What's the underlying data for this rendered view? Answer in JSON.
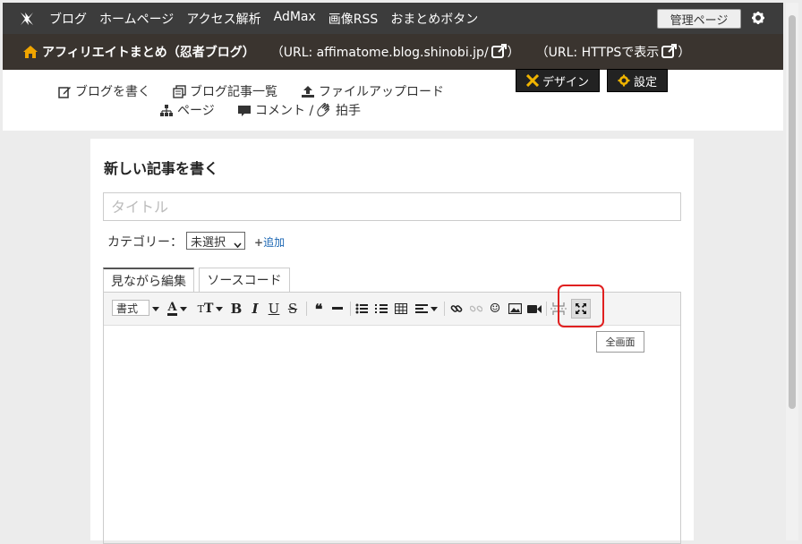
{
  "topnav": {
    "items": [
      "ブログ",
      "ホームページ",
      "アクセス解析",
      "AdMax",
      "画像RSS",
      "おまとめボタン"
    ],
    "admin_label": "管理ページ",
    "bg": "#3c3c3c"
  },
  "blogbar": {
    "blog_name": "アフィリエイトまとめ（忍者ブログ）",
    "url_label": "（URL: affimatome.blog.shinobi.jp/",
    "https_label": "（URL: HTTPSで表示",
    "bg": "#3a342f",
    "home_color": "#f0a500"
  },
  "subnav": {
    "write": "ブログを書く",
    "list": "ブログ記事一覧",
    "upload": "ファイルアップロード",
    "page": "ページ",
    "comment": "コメント /",
    "clap": "拍手",
    "design": "デザイン",
    "settings": "設定",
    "accent": "#f0b400"
  },
  "editor": {
    "heading": "新しい記事を書く",
    "title_placeholder": "タイトル",
    "category_label": "カテゴリー：",
    "category_value": "未選択",
    "add_label": "追加",
    "tab_wysiwyg": "見ながら編集",
    "tab_source": "ソースコード",
    "format_label": "書式",
    "tooltip": "全画面",
    "highlight_color": "#e02020"
  }
}
